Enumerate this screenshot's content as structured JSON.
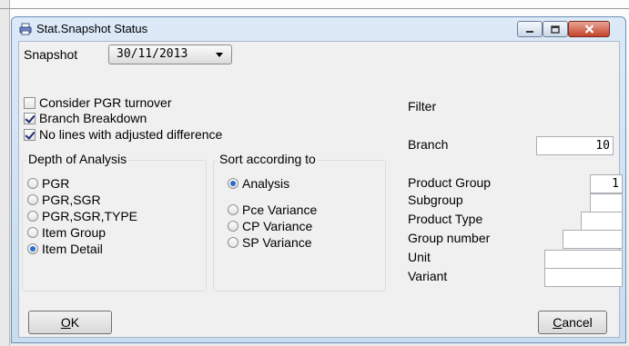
{
  "window": {
    "title": "Stat.Snapshot Status"
  },
  "snapshot": {
    "label": "Snapshot",
    "value": "30/11/2013"
  },
  "options": [
    {
      "label": "Consider PGR turnover",
      "checked": false
    },
    {
      "label": "Branch Breakdown",
      "checked": true
    },
    {
      "label": "No lines with adjusted difference",
      "checked": true
    }
  ],
  "depth": {
    "title": "Depth of Analysis",
    "items": [
      {
        "label": "PGR",
        "selected": false
      },
      {
        "label": "PGR,SGR",
        "selected": false
      },
      {
        "label": "PGR,SGR,TYPE",
        "selected": false
      },
      {
        "label": "Item Group",
        "selected": false
      },
      {
        "label": "Item Detail",
        "selected": true
      }
    ]
  },
  "sort": {
    "title": "Sort according to",
    "items": [
      {
        "label": "Analysis",
        "selected": true
      },
      {
        "label": "Pce Variance",
        "selected": false
      },
      {
        "label": "CP Variance",
        "selected": false
      },
      {
        "label": "SP Variance",
        "selected": false
      }
    ]
  },
  "filter": {
    "title": "Filter",
    "branch": {
      "label": "Branch",
      "value": "10"
    },
    "fields": [
      {
        "label": "Product Group",
        "value": "1"
      },
      {
        "label": "Subgroup",
        "value": ""
      },
      {
        "label": "Product Type",
        "value": ""
      },
      {
        "label": "Group number",
        "value": ""
      },
      {
        "label": "Unit",
        "value": ""
      },
      {
        "label": "Variant",
        "value": ""
      }
    ]
  },
  "buttons": {
    "ok": "OK",
    "ok_mnemonic": "O",
    "ok_rest": "K",
    "cancel_mnemonic": "C",
    "cancel_rest": "ancel"
  },
  "icons": {
    "app": "printer-icon",
    "minimize": "minimize-icon",
    "maximize": "maximize-icon",
    "close": "close-icon"
  },
  "colors": {
    "accent": "#2a6fd0",
    "close": "#c4432a",
    "frame": "#c9dcf0"
  }
}
